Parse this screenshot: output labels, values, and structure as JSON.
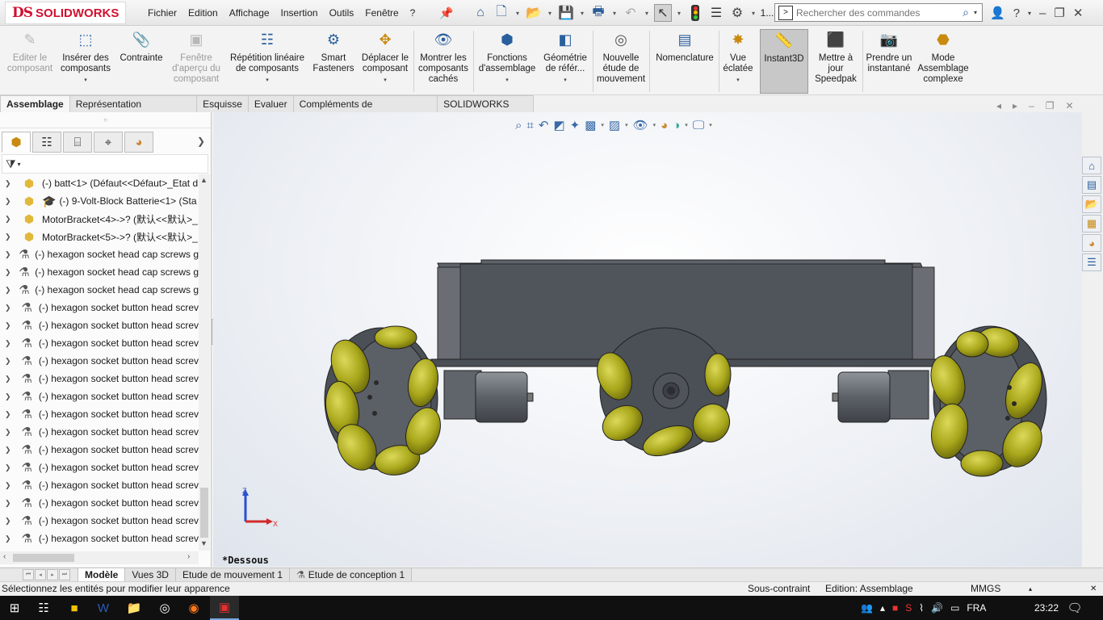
{
  "app": {
    "logo_ds": "DS",
    "logo_name": "SOLIDWORKS",
    "menus": [
      "Fichier",
      "Edition",
      "Affichage",
      "Insertion",
      "Outils",
      "Fenêtre",
      "?"
    ],
    "pin_icon": "pin-icon",
    "qtb_extra": "1...",
    "search_placeholder": "Rechercher des commandes"
  },
  "commands": [
    {
      "label": "Editer le composant",
      "icon": "edit-component-icon",
      "disabled": true
    },
    {
      "label": "Insérer des composants",
      "icon": "insert-components-icon",
      "disabled": false
    },
    {
      "label": "Contrainte",
      "icon": "mate-paperclip-icon",
      "disabled": false
    },
    {
      "label": "Fenêtre d'aperçu du composant",
      "icon": "preview-window-icon",
      "disabled": true
    },
    {
      "label": "Répétition linéaire de composants",
      "icon": "linear-pattern-icon",
      "disabled": false
    },
    {
      "label": "Smart Fasteners",
      "icon": "smart-fasteners-icon",
      "disabled": false
    },
    {
      "label": "Déplacer le composant",
      "icon": "move-component-icon",
      "disabled": false
    },
    {
      "label": "Montrer les composants cachés",
      "icon": "show-hidden-icon",
      "disabled": false
    },
    {
      "label": "Fonctions d'assemblage",
      "icon": "assembly-features-icon",
      "disabled": false
    },
    {
      "label": "Géométrie de référ...",
      "icon": "reference-geometry-icon",
      "disabled": false
    },
    {
      "label": "Nouvelle étude de mouvement",
      "icon": "motion-study-icon",
      "disabled": false
    },
    {
      "label": "Nomenclature",
      "icon": "bom-icon",
      "disabled": false
    },
    {
      "label": "Vue éclatée",
      "icon": "exploded-view-icon",
      "disabled": false
    },
    {
      "label": "Instant3D",
      "icon": "instant3d-icon",
      "disabled": false,
      "active": true
    },
    {
      "label": "Mettre à jour Speedpak",
      "icon": "speedpak-icon",
      "disabled": false
    },
    {
      "label": "Prendre un instantané",
      "icon": "snapshot-camera-icon",
      "disabled": false
    },
    {
      "label": "Mode Assemblage complexe",
      "icon": "large-assembly-icon",
      "disabled": false
    }
  ],
  "cm_tabs": [
    "Assemblage",
    "Représentation schématique",
    "Esquisse",
    "Evaluer",
    "Compléments de SOLIDWORKS",
    "SOLIDWORKS MBD"
  ],
  "tree": [
    {
      "label": "(-) batt<1> (Défaut<<Défaut>_Etat d",
      "type": "part"
    },
    {
      "label": "(-) 9-Volt-Block Batterie<1> (Sta",
      "type": "part2"
    },
    {
      "label": "MotorBracket<4>->? (默认<<默认>_",
      "type": "part"
    },
    {
      "label": "MotorBracket<5>->? (默认<<默认>_",
      "type": "part"
    },
    {
      "label": "(-) hexagon socket head cap screws g",
      "type": "screw"
    },
    {
      "label": "(-) hexagon socket head cap screws g",
      "type": "screw"
    },
    {
      "label": "(-) hexagon socket head cap screws g",
      "type": "screw"
    },
    {
      "label": "(-) hexagon socket button head screv",
      "type": "screw"
    },
    {
      "label": "(-) hexagon socket button head screv",
      "type": "screw"
    },
    {
      "label": "(-) hexagon socket button head screv",
      "type": "screw"
    },
    {
      "label": "(-) hexagon socket button head screv",
      "type": "screw"
    },
    {
      "label": "(-) hexagon socket button head screv",
      "type": "screw"
    },
    {
      "label": "(-) hexagon socket button head screv",
      "type": "screw"
    },
    {
      "label": "(-) hexagon socket button head screv",
      "type": "screw"
    },
    {
      "label": "(-) hexagon socket button head screv",
      "type": "screw"
    },
    {
      "label": "(-) hexagon socket button head screv",
      "type": "screw"
    },
    {
      "label": "(-) hexagon socket button head screv",
      "type": "screw"
    },
    {
      "label": "(-) hexagon socket button head screv",
      "type": "screw"
    },
    {
      "label": "(-) hexagon socket button head screv",
      "type": "screw"
    },
    {
      "label": "(-) hexagon socket button head screv",
      "type": "screw"
    },
    {
      "label": "(-) hexagon socket button head screv",
      "type": "screw"
    },
    {
      "label": "(-) hexagon socket button head screv",
      "type": "screw"
    }
  ],
  "viewport": {
    "view_name": "*Dessous",
    "triad_z": "Z",
    "triad_x": "X"
  },
  "model_tabs": [
    "Modèle",
    "Vues 3D",
    "Etude de mouvement 1",
    "Etude de conception 1"
  ],
  "status": {
    "message": "Sélectionnez les entités pour modifier leur apparence",
    "state": "Sous-contraint",
    "mode": "Edition: Assemblage",
    "units": "MMGS"
  },
  "taskbar": {
    "lang": "FRA",
    "time": "23:22"
  },
  "colors": {
    "roller_yellow": "#a8a61a",
    "body_gray": "#555a63",
    "accent_blue": "#2a5f9e"
  }
}
